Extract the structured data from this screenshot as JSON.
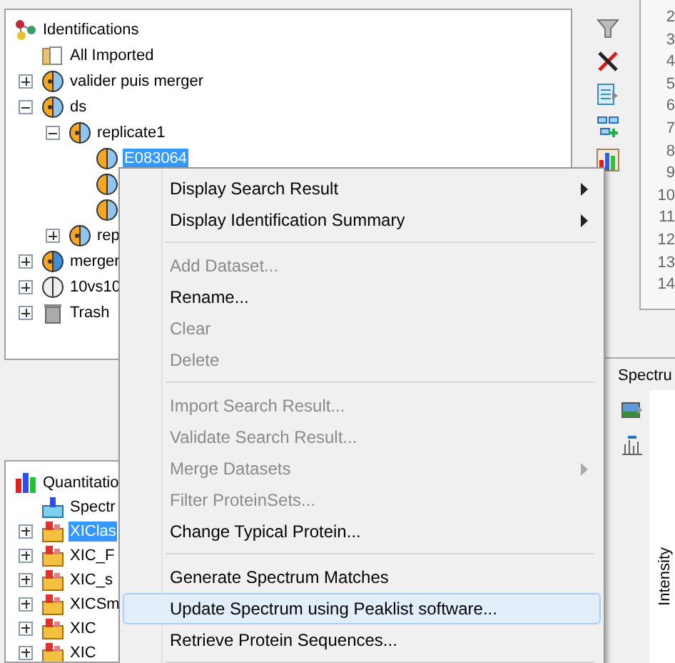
{
  "identifications_tree": {
    "items": [
      {
        "label": "Identifications",
        "kind": "identifications",
        "selected": false,
        "children": [
          {
            "label": "All Imported",
            "kind": "folder",
            "selected": false
          },
          {
            "label": "valider puis merger",
            "kind": "dataset",
            "expanded": false,
            "selected": false
          },
          {
            "label": "ds",
            "kind": "dataset",
            "expanded": true,
            "selected": false,
            "children": [
              {
                "label": "replicate1",
                "kind": "dataset",
                "expanded": true,
                "selected": false,
                "children": [
                  {
                    "label": "E083064",
                    "kind": "result",
                    "selected": true
                  },
                  {
                    "kind": "result"
                  },
                  {
                    "kind": "result"
                  }
                ]
              },
              {
                "label": "rep",
                "kind": "dataset",
                "expanded": false,
                "selected": false
              }
            ]
          },
          {
            "label": "merger",
            "kind": "merged",
            "expanded": false,
            "selected": false
          },
          {
            "label": "10vs10",
            "kind": "empty",
            "expanded": false,
            "selected": false
          },
          {
            "label": "Trash",
            "kind": "trash",
            "expanded": false,
            "selected": false
          }
        ]
      }
    ]
  },
  "line_numbers": [
    "2",
    "3",
    "4",
    "5",
    "6",
    "7",
    "8",
    "9",
    "10",
    "11",
    "12",
    "13",
    "14"
  ],
  "quantitation_tree": {
    "items": [
      {
        "label": "Quantitatio",
        "kind": "quant",
        "selected": false,
        "children": [
          {
            "label": "Spectr",
            "kind": "sc",
            "selected": false
          },
          {
            "label": "XIClas",
            "kind": "xic",
            "expanded": false,
            "selected": true
          },
          {
            "label": "XIC_F",
            "kind": "xic",
            "expanded": false,
            "selected": false
          },
          {
            "label": "XIC_s",
            "kind": "xic",
            "expanded": false,
            "selected": false
          },
          {
            "label": "XICSm",
            "kind": "xic",
            "expanded": false,
            "selected": false
          },
          {
            "label": "XIC",
            "kind": "xic",
            "expanded": false,
            "selected": false
          },
          {
            "label": "XIC",
            "kind": "xic",
            "expanded": false,
            "selected": false
          }
        ]
      }
    ]
  },
  "spectrum_panel": {
    "tab": "Spectru",
    "y_axis_label": "Intensity"
  },
  "context_menu": [
    {
      "kind": "item",
      "label": "Display Search Result",
      "disabled": false,
      "submenu": true,
      "selected": false
    },
    {
      "kind": "item",
      "label": "Display Identification Summary",
      "disabled": false,
      "submenu": true,
      "selected": false
    },
    {
      "kind": "separator"
    },
    {
      "kind": "item",
      "label": "Add Dataset...",
      "disabled": true,
      "submenu": false,
      "selected": false
    },
    {
      "kind": "item",
      "label": "Rename...",
      "disabled": false,
      "submenu": false,
      "selected": false
    },
    {
      "kind": "item",
      "label": "Clear",
      "disabled": true,
      "submenu": false,
      "selected": false
    },
    {
      "kind": "item",
      "label": "Delete",
      "disabled": true,
      "submenu": false,
      "selected": false
    },
    {
      "kind": "separator"
    },
    {
      "kind": "item",
      "label": "Import Search Result...",
      "disabled": true,
      "submenu": false,
      "selected": false
    },
    {
      "kind": "item",
      "label": "Validate Search Result...",
      "disabled": true,
      "submenu": false,
      "selected": false
    },
    {
      "kind": "item",
      "label": "Merge Datasets",
      "disabled": true,
      "submenu": true,
      "selected": false
    },
    {
      "kind": "item",
      "label": "Filter ProteinSets...",
      "disabled": true,
      "submenu": false,
      "selected": false
    },
    {
      "kind": "item",
      "label": "Change Typical Protein...",
      "disabled": false,
      "submenu": false,
      "selected": false
    },
    {
      "kind": "separator"
    },
    {
      "kind": "item",
      "label": "Generate Spectrum Matches",
      "disabled": false,
      "submenu": false,
      "selected": false
    },
    {
      "kind": "item",
      "label": "Update Spectrum using Peaklist software...",
      "disabled": false,
      "submenu": false,
      "selected": true
    },
    {
      "kind": "item",
      "label": "Retrieve Protein Sequences...",
      "disabled": false,
      "submenu": false,
      "selected": false
    },
    {
      "kind": "separator"
    }
  ]
}
